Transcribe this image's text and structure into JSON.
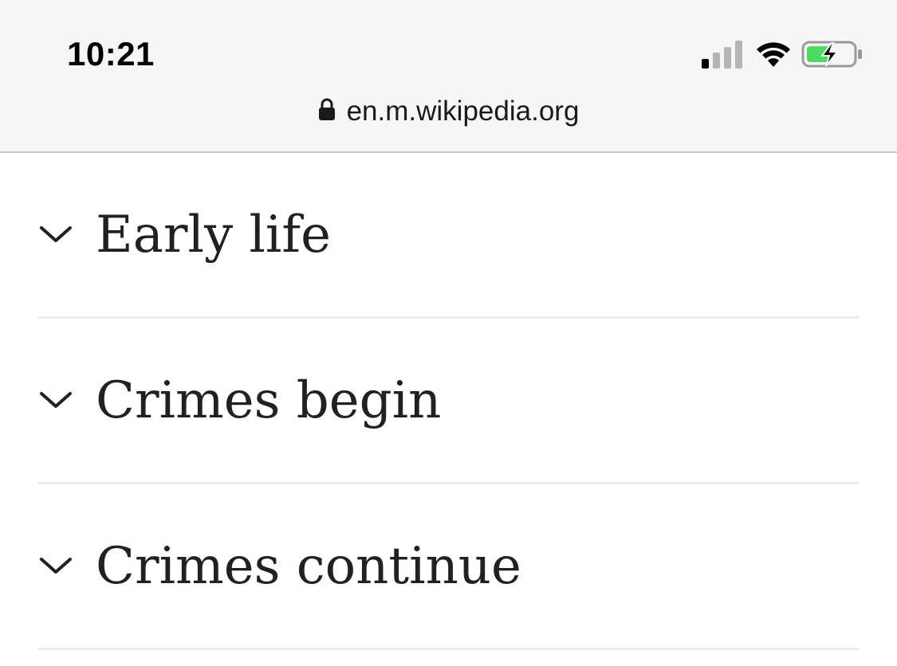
{
  "status_bar": {
    "time": "10:21",
    "icons": [
      "signal-icon",
      "wifi-icon",
      "battery-charging-icon"
    ]
  },
  "address_bar": {
    "url": "en.m.wikipedia.org",
    "icon": "lock-icon"
  },
  "sections": [
    {
      "label": "Early life",
      "icon": "chevron-down-icon"
    },
    {
      "label": "Crimes begin",
      "icon": "chevron-down-icon"
    },
    {
      "label": "Crimes continue",
      "icon": "chevron-down-icon"
    }
  ],
  "colors": {
    "top_bar_bg": "#f6f6f6",
    "heading_text": "#202122",
    "divider": "#eaecf0",
    "battery_fill": "#4cd964"
  }
}
